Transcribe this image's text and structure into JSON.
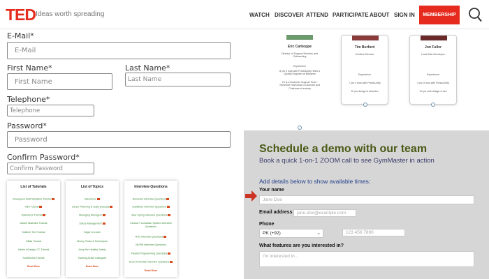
{
  "header": {
    "logo": "TED",
    "tagline": "Ideas worth spreading",
    "nav": [
      "WATCH",
      "DISCOVER",
      "ATTEND",
      "PARTICIPATE",
      "ABOUT",
      "SIGN IN"
    ],
    "membership_label": "MEMBERSHIP"
  },
  "form": {
    "email_label": "E-Mail*",
    "email_placeholder": "E-Mail",
    "first_label": "First Name*",
    "first_placeholder": "First Name",
    "last_label": "Last Name*",
    "last_placeholder": "Last Name",
    "tel_label": "Telephone*",
    "tel_placeholder": "Telephone",
    "password_label": "Password*",
    "password_placeholder": "Password",
    "confirm_label": "Confirm Password*",
    "confirm_placeholder": "Confirm Password"
  },
  "boxes": [
    {
      "title": "List of Tutorials",
      "items": [
        "Developers Best Websites Tutorial",
        "VBA Tutorial",
        "Salesforce Tutorial",
        "Adobe Illustrator Tutorial",
        "Sublime Text Tutorial",
        "Gitlab Tutorial",
        "Adobe InDesign CC Tutorial",
        "SolidWorks Tutorial"
      ],
      "more": "Read More"
    },
    {
      "title": "List of Topics",
      "items": [
        "Salesforce",
        "Career Planning is really practical",
        "Managing Managers",
        "Stress Management",
        "Eager to Learn",
        "Money Tricks & Techniques",
        "Keep the Healthy Safety",
        "Tackling Active Dialogues"
      ],
      "more": "Read More"
    },
    {
      "title": "Interview Questions",
      "items": [
        "Remedial Interview Questions",
        "Substitute Interview Questions",
        "Java Spring Interview Questions",
        "Circular Foundation System Interview Questions",
        "RTE Interview Questions",
        "MVVM Interview Questions",
        "Parallel Programming Questions",
        "Excel Formulas Interview Questions"
      ],
      "more": "Read More"
    }
  ],
  "team": [
    {
      "name": "Eric Carboppe",
      "role": "Director of Support Services and Onboarding",
      "section": "Experience",
      "text": "8 yrs 3 mos with Fresh&Jelly. Web a Quality Engineer of Bitwares",
      "extra": "10 yrs Customer Support Tech / Technical Team lead Co-director and Chairman of society"
    },
    {
      "name": "Tim Burford",
      "role": "Creative Director",
      "section": "Experience",
      "text": "7 yrs 4 mos with Fresh&Jelly",
      "extra": "10 yrs design & direction"
    },
    {
      "name": "Jon Fuller",
      "role": "Lead Web Developer",
      "section": "Experience",
      "text": "4 yrs 3 mos with Fresh&Jelly",
      "extra": "10 yrs web design & dev"
    }
  ],
  "demo": {
    "title": "Schedule a demo with our team",
    "subtitle": "Book a quick 1-on-1 ZOOM call to see GymMaster in action",
    "section": "Add details below to show available times:",
    "name_label": "Your name",
    "name_placeholder": "Jane Doe",
    "email_label": "Email address",
    "email_placeholder": "jane.doe@example.com",
    "phone_label": "Phone",
    "country_value": "PK (+92)",
    "phone_placeholder": "123 456 7890",
    "features_label": "What features are you interested in?",
    "features_placeholder": "I'm interested in..."
  },
  "colors": {
    "ted_red": "#e62b1e",
    "demo_title": "#4a5a16",
    "demo_sub": "#3a3a6a",
    "demo_section": "#233e8a",
    "arrow": "#cc3322"
  }
}
